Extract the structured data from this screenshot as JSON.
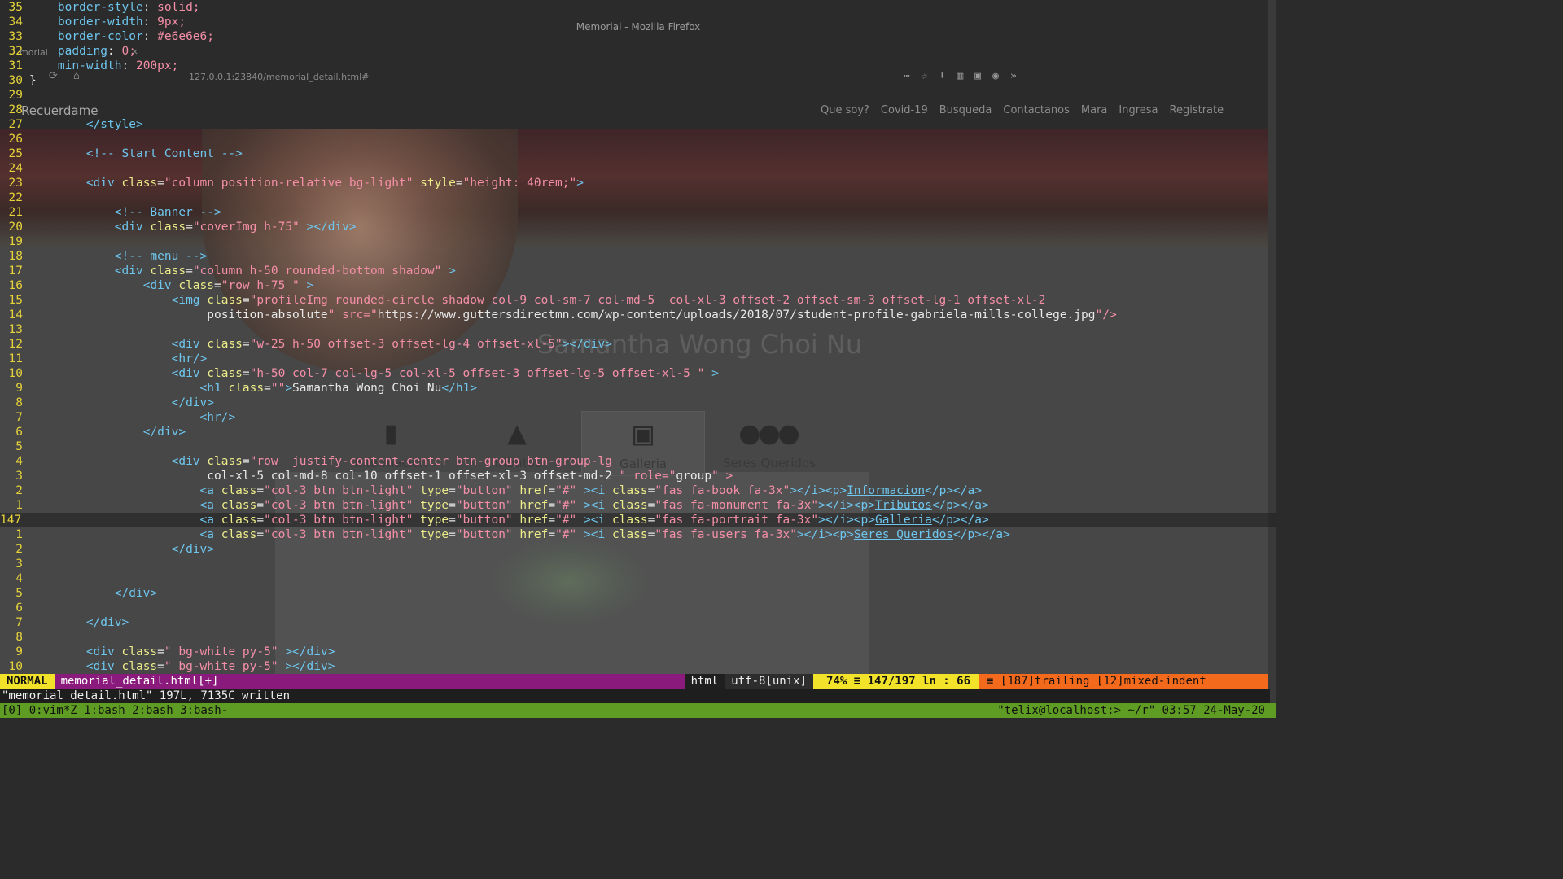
{
  "browser": {
    "window_title": "Memorial - Mozilla Firefox",
    "tab_label": "morial",
    "url": "127.0.0.1:23840/memorial_detail.html#",
    "brand": "Recuerdame",
    "menu": [
      "Que soy?",
      "Covid-19",
      "Busqueda",
      "Contactanos",
      "Mara",
      "Ingresa",
      "Registrate"
    ],
    "profile_name": "Samantha Wong Choi Nu",
    "buttons": [
      {
        "label": "Informacion",
        "icon": "book-icon"
      },
      {
        "label": "Tributos",
        "icon": "monument-icon"
      },
      {
        "label": "Galleria",
        "icon": "portrait-icon"
      },
      {
        "label": "Seres Queridos",
        "icon": "users-icon"
      }
    ]
  },
  "editor": {
    "lines": [
      {
        "n": "35",
        "text": "    border-style: solid;"
      },
      {
        "n": "34",
        "text": "    border-width: 9px;"
      },
      {
        "n": "33",
        "text": "    border-color: #e6e6e6;"
      },
      {
        "n": "32",
        "text": "    padding: 0;"
      },
      {
        "n": "31",
        "text": "    min-width: 200px;"
      },
      {
        "n": "30",
        "text": "}"
      },
      {
        "n": "29",
        "text": ""
      },
      {
        "n": "28",
        "text": ""
      },
      {
        "n": "27",
        "text": "        </style>"
      },
      {
        "n": "26",
        "text": ""
      },
      {
        "n": "25",
        "text": "        <!-- Start Content -->"
      },
      {
        "n": "24",
        "text": ""
      },
      {
        "n": "23",
        "text": "        <div class=\"column position-relative bg-light\" style=\"height: 40rem;\">"
      },
      {
        "n": "22",
        "text": ""
      },
      {
        "n": "21",
        "text": "            <!-- Banner -->"
      },
      {
        "n": "20",
        "text": "            <div class=\"coverImg h-75\" ></div>"
      },
      {
        "n": "19",
        "text": ""
      },
      {
        "n": "18",
        "text": "            <!-- menu -->"
      },
      {
        "n": "17",
        "text": "            <div class=\"column h-50 rounded-bottom shadow\" >"
      },
      {
        "n": "16",
        "text": "                <div class=\"row h-75 \" >"
      },
      {
        "n": "15",
        "text": "                    <img class=\"profileImg rounded-circle shadow col-9 col-sm-7 col-md-5  col-xl-3 offset-2 offset-sm-3 offset-lg-1 offset-xl-2"
      },
      {
        "n": "14",
        "text": "                         position-absolute\" src=\"https://www.guttersdirectmn.com/wp-content/uploads/2018/07/student-profile-gabriela-mills-college.jpg\"/>"
      },
      {
        "n": "13",
        "text": ""
      },
      {
        "n": "12",
        "text": "                    <div class=\"w-25 h-50 offset-3 offset-lg-4 offset-xl-5\"></div>"
      },
      {
        "n": "11",
        "text": "                    <hr/>"
      },
      {
        "n": "10",
        "text": "                    <div class=\"h-50 col-7 col-lg-5 col-xl-5 offset-3 offset-lg-5 offset-xl-5 \" >"
      },
      {
        "n": "9",
        "text": "                        <h1 class=\"\">Samantha Wong Choi Nu</h1>"
      },
      {
        "n": "8",
        "text": "                    </div>"
      },
      {
        "n": "7",
        "text": "                        <hr/>"
      },
      {
        "n": "6",
        "text": "                </div>"
      },
      {
        "n": "5",
        "text": ""
      },
      {
        "n": "4",
        "text": "                    <div class=\"row  justify-content-center btn-group btn-group-lg"
      },
      {
        "n": "3",
        "text": "                         col-xl-5 col-md-8 col-10 offset-1 offset-xl-3 offset-md-2 \" role=\"group\" >"
      },
      {
        "n": "2",
        "text": "                        <a class=\"col-3 btn btn-light\" type=\"button\" href=\"#\" ><i class=\"fas fa-book fa-3x\"></i><p>Informacion</p></a>"
      },
      {
        "n": "1",
        "text": "                        <a class=\"col-3 btn btn-light\" type=\"button\" href=\"#\" ><i class=\"fas fa-monument fa-3x\"></i><p>Tributos</p></a>"
      },
      {
        "n": "147",
        "text": "                        <a class=\"col-3 btn btn-light\" type=\"button\" href=\"#\" ><i class=\"fas fa-portrait fa-3x\"></i><p>Galleria</p></a>",
        "current": true
      },
      {
        "n": "1",
        "text": "                        <a class=\"col-3 btn btn-light\" type=\"button\" href=\"#\" ><i class=\"fas fa-users fa-3x\"></i><p>Seres Queridos</p></a>"
      },
      {
        "n": "2",
        "text": "                    </div>"
      },
      {
        "n": "3",
        "text": ""
      },
      {
        "n": "4",
        "text": ""
      },
      {
        "n": "5",
        "text": "            </div>"
      },
      {
        "n": "6",
        "text": ""
      },
      {
        "n": "7",
        "text": "        </div>"
      },
      {
        "n": "8",
        "text": ""
      },
      {
        "n": "9",
        "text": "        <div class=\" bg-white py-5\" ></div>"
      },
      {
        "n": "10",
        "text": "        <div class=\" bg-white py-5\" ></div>"
      }
    ]
  },
  "statusline": {
    "mode": "NORMAL",
    "filename": "memorial_detail.html[+]",
    "filetype": "html",
    "encoding": "utf-8[unix]",
    "position": "74% ≡  147/197 ln :  66",
    "warnings": "≡ [187]trailing [12]mixed-indent"
  },
  "cmdline": "\"memorial_detail.html\" 197L, 7135C written",
  "tmux": {
    "left": "[0] 0:vim*Z 1:bash  2:bash  3:bash-",
    "right": "\"telix@localhost:> ~/r\" 03:57 24-May-20"
  },
  "colors": {
    "line_number": "#e6d33a",
    "mode_bg": "#f2e32a",
    "filename_bg": "#8b1a7d",
    "warn_bg": "#f36a1c",
    "tmux_bg": "#5f9c23"
  }
}
